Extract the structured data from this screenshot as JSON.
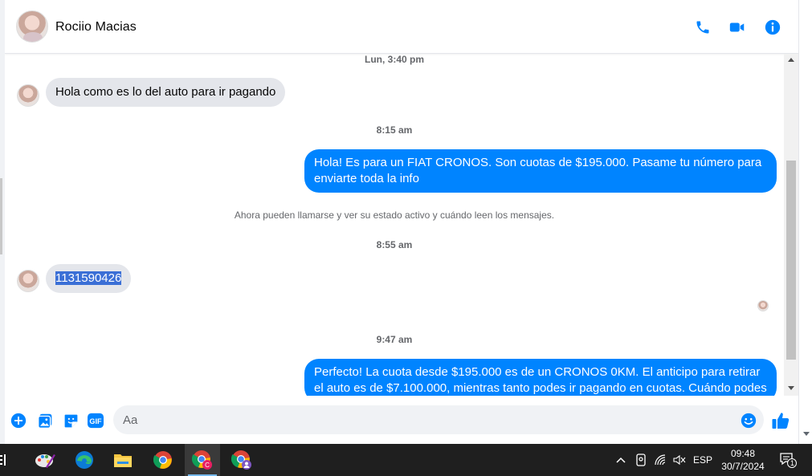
{
  "header": {
    "contact_name": "Rociio Macias",
    "icons": [
      "phone-icon",
      "video-camera-icon",
      "info-icon"
    ],
    "accent_color": "#0084ff"
  },
  "conversation": {
    "timestamp_1": "Lun, 3:40 pm",
    "incoming_1": "Hola como es lo del auto para ir pagando",
    "timestamp_2": "8:15 am",
    "outgoing_1": "Hola! Es para un FIAT CRONOS. Son cuotas de $195.000. Pasame tu número para enviarte toda la info",
    "notice": "Ahora pueden llamarse y ver su estado activo y cuándo leen los mensajes.",
    "timestamp_3": "8:55 am",
    "incoming_2": "1131590426",
    "timestamp_4": "9:47 am",
    "outgoing_2": "Perfecto! La cuota desde $195.000 es de un CRONOS 0KM. El anticipo para retirar el auto es de $7.100.000, mientras tanto podes ir pagando en cuotas. Cuándo podes"
  },
  "composer": {
    "placeholder": "Aa",
    "icons": [
      "add-icon",
      "image-icon",
      "sticker-icon",
      "gif-icon",
      "emoji-icon",
      "thumbs-up-icon"
    ],
    "gif_label": "GIF"
  },
  "taskbar": {
    "apps": [
      "paint-app-icon",
      "edge-browser-icon",
      "file-explorer-icon",
      "chrome-icon",
      "chrome-profile-c-icon",
      "chrome-profile-icon"
    ],
    "language": "ESP",
    "time": "09:48",
    "date": "30/7/2024",
    "notification_count": "1"
  }
}
